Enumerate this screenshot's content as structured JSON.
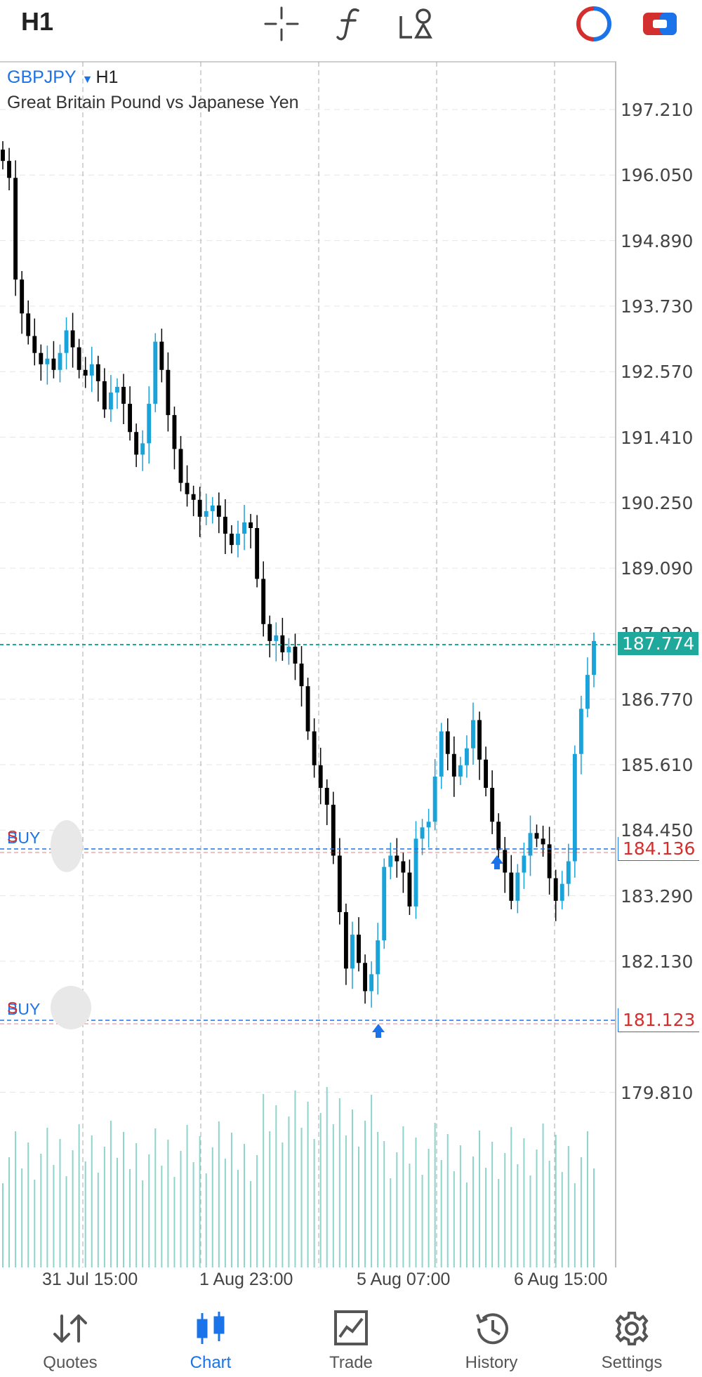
{
  "toolbar": {
    "timeframe": "H1",
    "icons": [
      "crosshair-icon",
      "indicator-function-icon",
      "objects-icon",
      "one-click-trading-icon",
      "trade-panel-icon"
    ]
  },
  "chart": {
    "symbol": "GBPJPY",
    "timeframe": "H1",
    "description": "Great Britain Pound vs Japanese Yen",
    "price_levels": [
      "197.210",
      "196.050",
      "194.890",
      "193.730",
      "192.570",
      "191.410",
      "190.250",
      "189.090",
      "187.930",
      "186.770",
      "185.610",
      "184.450",
      "183.290",
      "182.130",
      "179.810"
    ],
    "current_price": "187.774",
    "orders": [
      {
        "label": "BUY",
        "price": "184.136"
      },
      {
        "label": "BUY",
        "price": "181.123"
      }
    ],
    "date_labels": [
      "31 Jul 15:00",
      "1 Aug 23:00",
      "5 Aug 07:00",
      "6 Aug 15:00"
    ],
    "colors": {
      "bull": "#1aa3d9",
      "bear": "#000000",
      "current": "#1fa89c",
      "order": "#d32f2f",
      "accent": "#1a73e8"
    }
  },
  "nav": {
    "items": [
      {
        "label": "Quotes",
        "icon": "quotes-arrows-icon"
      },
      {
        "label": "Chart",
        "icon": "chart-candles-icon",
        "active": true
      },
      {
        "label": "Trade",
        "icon": "trade-chart-icon"
      },
      {
        "label": "History",
        "icon": "history-clock-icon"
      },
      {
        "label": "Settings",
        "icon": "settings-gear-icon"
      }
    ]
  }
}
